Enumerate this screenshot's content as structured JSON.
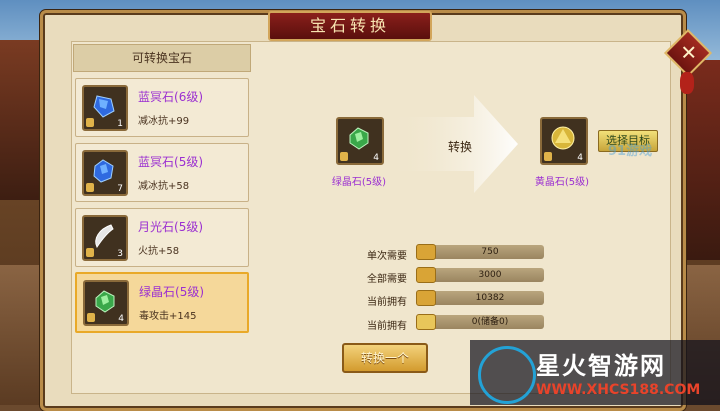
{
  "window": {
    "title": "宝石转换",
    "close_label": "✕"
  },
  "gem_list": {
    "title": "可转换宝石",
    "items": [
      {
        "name": "蓝冥石",
        "level": "(6级)",
        "attr": "减冰抗+99",
        "count": "1",
        "color": "#2f6ae0",
        "icon": "blue-crystal-icon"
      },
      {
        "name": "蓝冥石",
        "level": "(5级)",
        "attr": "减冰抗+58",
        "count": "7",
        "color": "#2f6ae0",
        "icon": "blue-crystal-icon"
      },
      {
        "name": "月光石",
        "level": "(5级)",
        "attr": "火抗+58",
        "count": "3",
        "color": "#d8d8d8",
        "icon": "moon-crescent-icon"
      },
      {
        "name": "绿晶石",
        "level": "(5级)",
        "attr": "毒攻击+145",
        "count": "4",
        "color": "#3aa84a",
        "icon": "green-crystal-icon",
        "selected": true
      }
    ]
  },
  "conversion": {
    "source": {
      "name": "绿晶石(5级)",
      "count": "4"
    },
    "target": {
      "name": "黄晶石(5级)",
      "count": "4"
    },
    "arrow_label": "转换",
    "select_button": "选择目标"
  },
  "costs": [
    {
      "label": "单次需要",
      "value": "750"
    },
    {
      "label": "全部需要",
      "value": "3000"
    },
    {
      "label": "当前拥有",
      "value": "10382"
    },
    {
      "label": "当前拥有",
      "value": "0(储备0)"
    }
  ],
  "convert_button": "转换一个",
  "watermarks": {
    "game91": "91游戏",
    "site_name": "星火智游网",
    "site_url": "WWW.XHCS188.COM"
  }
}
